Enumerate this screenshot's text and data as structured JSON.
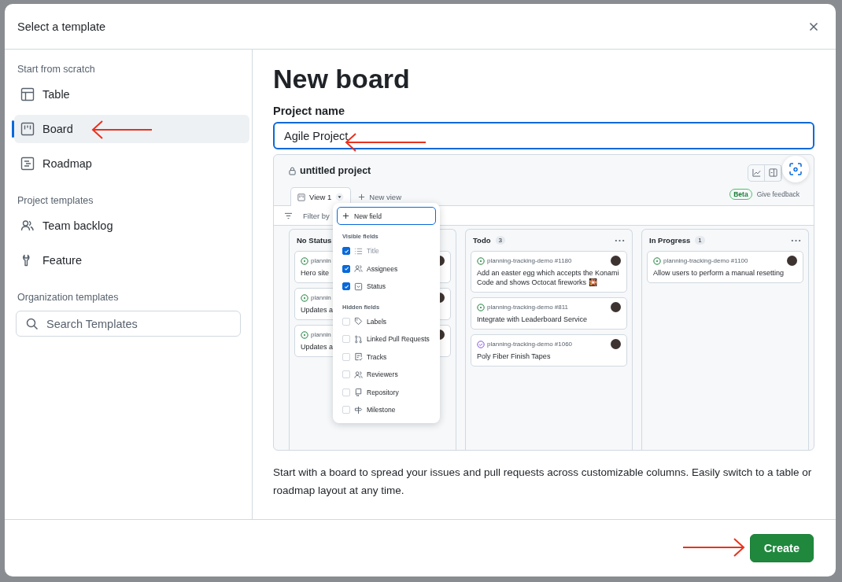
{
  "dialog": {
    "title": "Select a template"
  },
  "sidebar": {
    "sections": [
      {
        "heading": "Start from scratch",
        "items": [
          {
            "label": "Table",
            "kind": "table",
            "selected": false
          },
          {
            "label": "Board",
            "kind": "board",
            "selected": true
          },
          {
            "label": "Roadmap",
            "kind": "roadmap",
            "selected": false
          }
        ]
      },
      {
        "heading": "Project templates",
        "items": [
          {
            "label": "Team backlog",
            "kind": "people",
            "selected": false
          },
          {
            "label": "Feature",
            "kind": "feature",
            "selected": false
          }
        ]
      },
      {
        "heading": "Organization templates"
      }
    ],
    "search": {
      "placeholder": "Search Templates"
    }
  },
  "main": {
    "heading": "New board",
    "name_label": "Project name",
    "name_value": "Agile Project",
    "description": "Start with a board to spread your issues and pull requests across customizable columns. Easily switch to a table or roadmap layout at any time."
  },
  "preview": {
    "project_title": "untitled project",
    "tabs": [
      {
        "label": "View 1",
        "selected": true
      },
      {
        "label": "New view",
        "selected": false
      }
    ],
    "beta_badge": "Beta",
    "feedback_link": "Give feedback",
    "filter_placeholder": "Filter by",
    "columns": [
      {
        "title": "No Status",
        "cards": [
          {
            "ref": "plannin",
            "title": "Hero site",
            "completed": false
          },
          {
            "ref": "plannin",
            "title": "Updates a",
            "completed": false
          },
          {
            "ref": "plannin",
            "title": "Updates a",
            "completed": false
          }
        ]
      },
      {
        "title": "Todo",
        "count": "3",
        "cards": [
          {
            "ref": "planning-tracking-demo #1180",
            "title": "Add an easter egg which accepts the Konami Code and shows Octocat fireworks 🎇",
            "completed": false
          },
          {
            "ref": "planning-tracking-demo #811",
            "title": "Integrate with Leaderboard Service",
            "completed": false
          },
          {
            "ref": "planning-tracking-demo #1060",
            "title": "Poly Fiber Finish Tapes",
            "completed": true
          }
        ]
      },
      {
        "title": "In Progress",
        "count": "1",
        "cards": [
          {
            "ref": "planning-tracking-demo #1100",
            "title": "Allow users to perform a manual resetting",
            "completed": false
          }
        ]
      }
    ],
    "field_menu": {
      "new_field": "New field",
      "groups": [
        {
          "heading": "Visible fields",
          "items": [
            {
              "label": "Title",
              "kind": "list",
              "checked": true,
              "disabled": true
            },
            {
              "label": "Assignees",
              "kind": "people",
              "checked": true,
              "disabled": false
            },
            {
              "label": "Status",
              "kind": "select",
              "checked": true,
              "disabled": false
            }
          ]
        },
        {
          "heading": "Hidden fields",
          "items": [
            {
              "label": "Labels",
              "kind": "tag",
              "checked": false,
              "disabled": false
            },
            {
              "label": "Linked Pull Requests",
              "kind": "pull",
              "checked": false,
              "disabled": false
            },
            {
              "label": "Tracks",
              "kind": "tracks",
              "checked": false,
              "disabled": false
            },
            {
              "label": "Reviewers",
              "kind": "people",
              "checked": false,
              "disabled": false
            },
            {
              "label": "Repository",
              "kind": "repo",
              "checked": false,
              "disabled": false
            },
            {
              "label": "Milestone",
              "kind": "milestone",
              "checked": false,
              "disabled": false
            }
          ]
        }
      ]
    }
  },
  "footer": {
    "create_button": "Create"
  }
}
